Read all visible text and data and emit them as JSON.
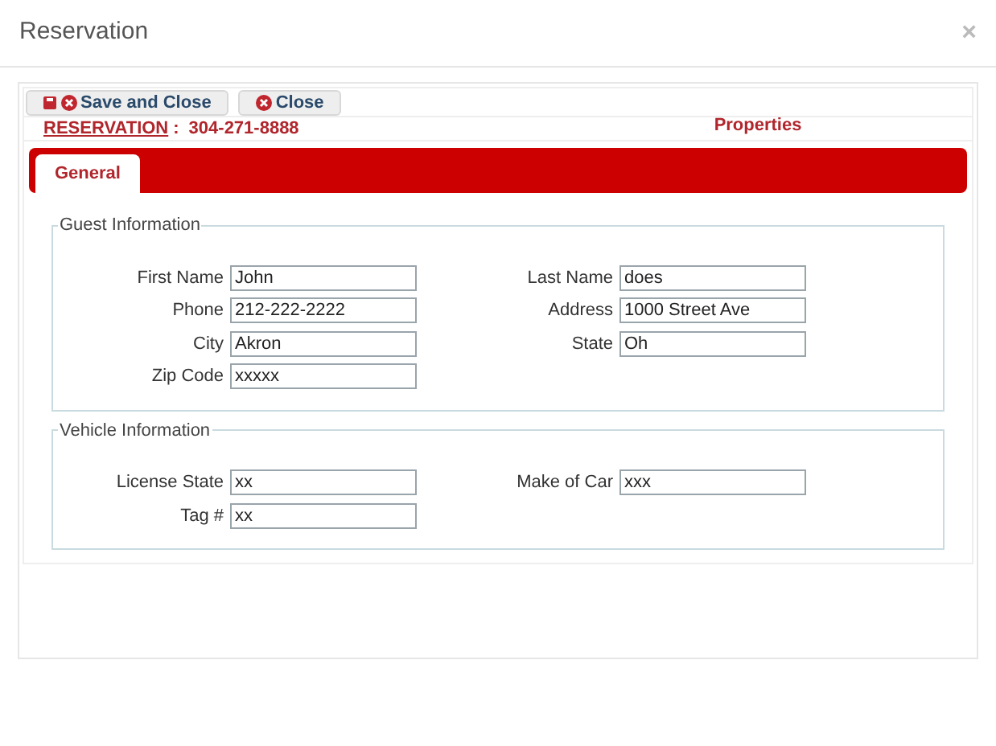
{
  "window": {
    "title": "Reservation",
    "close": "×"
  },
  "toolbar": {
    "buttons": [
      {
        "kind": "save_close",
        "label": "Save and Close"
      },
      {
        "kind": "close",
        "label": "Close"
      }
    ]
  },
  "header": {
    "link": "RESERVATION",
    "separator": ":",
    "phone": "304-271-8888",
    "properties": "Properties"
  },
  "tabs": [
    {
      "label": "General",
      "selected": true
    }
  ],
  "sections": [
    {
      "legend": "Guest Information",
      "rows": [
        [
          {
            "label": "First Name",
            "value": "John"
          },
          {
            "label": "Last Name",
            "value": "does"
          }
        ],
        [
          {
            "label": "Phone",
            "value": "212-222-2222"
          },
          {
            "label": "Address",
            "value": "1000 Street Ave"
          }
        ],
        [
          {
            "label": "City",
            "value": "Akron"
          },
          {
            "label": "State",
            "value": "Oh"
          }
        ],
        [
          {
            "label": "Zip Code",
            "value": "xxxxx"
          }
        ]
      ]
    },
    {
      "legend": "Vehicle Information",
      "rows": [
        [
          {
            "label": "License State",
            "value": "xx"
          },
          {
            "label": "Make of Car",
            "value": "xxx"
          }
        ],
        [
          {
            "label": "Tag #",
            "value": "xx"
          }
        ]
      ]
    }
  ]
}
